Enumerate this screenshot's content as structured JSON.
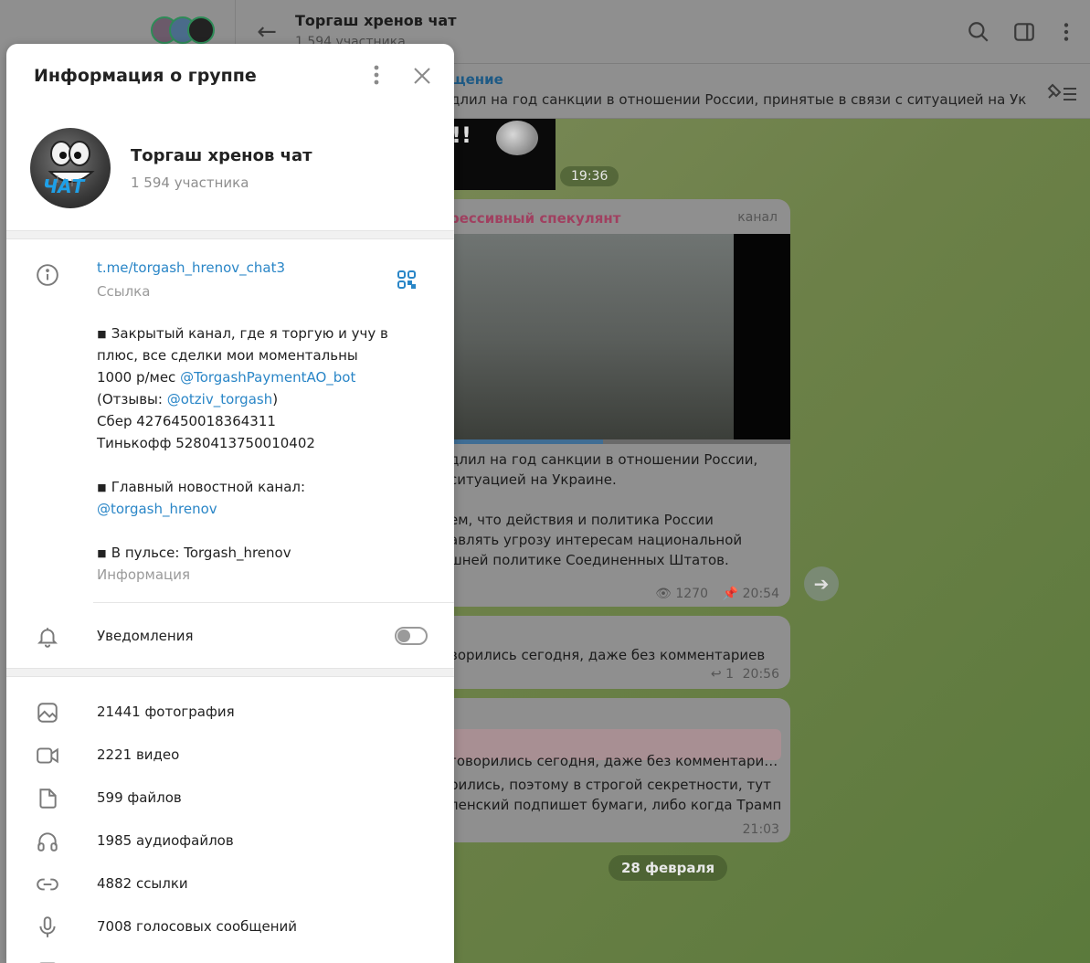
{
  "background": {
    "chat_title": "Торгаш хренов чат",
    "chat_members": "1 594 участника",
    "pinned_label": "щение",
    "pinned_text": "длил на год санкции в отношении России, принятые в связи с ситуацией на Ук…",
    "msg1_exclaim": "!!",
    "msg1_time": "19:36",
    "msg2_author": "рессивный спекулянт",
    "msg2_badge": "канал",
    "msg2_lines": [
      "длил на год санкции в отношении России,",
      "ситуацией на Украине.",
      "ем, что действия и политика России",
      "авлять угрозу интересам национальной",
      "шней политике Соединенных Штатов."
    ],
    "msg2_views": "1270",
    "msg2_time": "20:54",
    "msg2_progress": 0.47,
    "msg3_text": "ворились сегодня, даже без комментариев",
    "msg3_replies": "1",
    "msg3_time": "20:56",
    "msg4_quote": "говорились сегодня, даже без комментари…",
    "msg4_lines": [
      "рились, поэтому в строгой секретности,  тут",
      "ленский подпишет бумаги, либо когда Трамп"
    ],
    "msg4_time": "21:03",
    "date_chip": "28 февраля"
  },
  "modal": {
    "title": "Информация о группе",
    "group": {
      "name": "Торгаш хренов чат",
      "members": "1 594 участника",
      "avatar_label": "ЧАТ"
    },
    "link": {
      "url": "t.me/torgash_hrenov_chat3",
      "label": "Ссылка"
    },
    "description": {
      "l1": "◾ Закрытый канал, где я торгую и учу в",
      "l2": "плюс, все сделки мои моментальны",
      "l3_prefix": "1000 р/мес ",
      "l3_link": "@TorgashPaymentAO_bot",
      "l4_prefix": "(Отзывы: ",
      "l4_link": "@otziv_torgash",
      "l4_suffix": ")",
      "l5": "Сбер 4276450018364311",
      "l6": "Тинькофф 5280413750010402",
      "l7": "◾ Главный новостной канал:",
      "l8_link": "@torgash_hrenov",
      "l9": "◾ В пульсе: Torgash_hrenov",
      "label": "Информация"
    },
    "notifications": {
      "label": "Уведомления",
      "enabled": false
    },
    "media": {
      "photos": "21441 фотография",
      "videos": "2221 видео",
      "files": "599 файлов",
      "audio": "1985 аудиофайлов",
      "links": "4882 ссылки",
      "voice": "7008 голосовых сообщений"
    },
    "icons": {
      "info": "info-icon",
      "qr": "qr-code-icon",
      "bell": "bell-icon",
      "photo": "photo-icon",
      "video": "video-icon",
      "file": "file-icon",
      "audio": "headphones-icon",
      "link": "link-icon",
      "voice": "microphone-icon"
    },
    "colors": {
      "accent": "#2a86c7",
      "text": "#222222",
      "muted": "#9a9a9a"
    }
  }
}
